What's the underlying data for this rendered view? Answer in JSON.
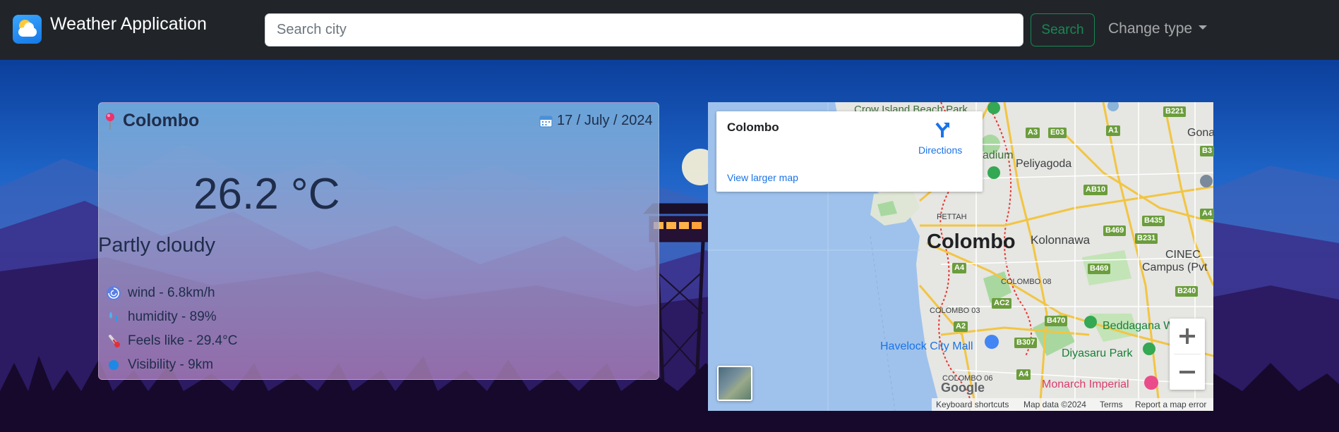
{
  "app": {
    "title": "Weather Application",
    "logo_icon": "weather-app-icon"
  },
  "navbar": {
    "search_placeholder": "Search city",
    "search_button": "Search",
    "change_type": "Change type"
  },
  "weather": {
    "city": "Colombo",
    "date": "17 / July / 2024",
    "temperature": "26.2 °C",
    "condition": "Partly cloudy",
    "stats": [
      {
        "icon": "cyclone-icon",
        "text": "wind - 6.8km/h"
      },
      {
        "icon": "sweat-droplets-icon",
        "text": "humidity - 89%"
      },
      {
        "icon": "thermometer-icon",
        "text": "Feels like - 29.4°C"
      },
      {
        "icon": "blue-circle-icon",
        "text": "Visibility - 9km"
      }
    ]
  },
  "map": {
    "place_title": "Colombo",
    "directions": "Directions",
    "view_larger": "View larger map",
    "google_logo": "Google",
    "attribution": {
      "keyboard": "Keyboard shortcuts",
      "map_data": "Map data ©2024",
      "terms": "Terms",
      "report": "Report a map error"
    },
    "labels": {
      "crow_island": "Crow Island Beach Park",
      "peliyagoda": "Peliyagoda",
      "adium": "adium",
      "gona": "Gona",
      "colombo": "Colombo",
      "kolonnawa": "Kolonnawa",
      "pettah": "PETTAH",
      "colombo_08": "COLOMBO 08",
      "colombo_03": "COLOMBO 03",
      "colombo_06": "COLOMBO 06",
      "cinec": "CINEC",
      "cinec2": "Campus (Pvt",
      "havelock": "Havelock City Mall",
      "beddagana": "Beddagana W",
      "diyasaru": "Diyasaru Park",
      "monarch": "Monarch Imperial"
    },
    "shields": [
      "B221",
      "A1",
      "A3",
      "E03",
      "B3",
      "AB10",
      "B435",
      "A4",
      "B469",
      "B231",
      "A4",
      "B469",
      "AC2",
      "B240",
      "A2",
      "B470",
      "B307",
      "A4"
    ]
  }
}
